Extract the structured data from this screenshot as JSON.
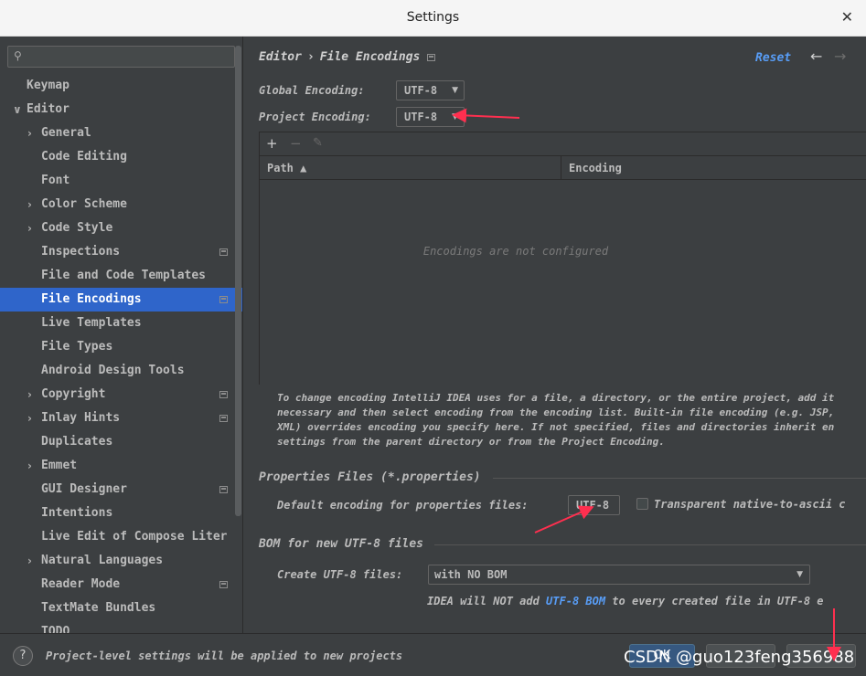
{
  "window": {
    "title": "Settings",
    "close_glyph": "✕"
  },
  "sidebar": {
    "search_icon": "search-icon",
    "items": [
      {
        "label": "Keymap",
        "level": 0,
        "arrow": "",
        "proj": false,
        "selected": false
      },
      {
        "label": "Editor",
        "level": 0,
        "arrow": "∨",
        "proj": false,
        "selected": false
      },
      {
        "label": "General",
        "level": 1,
        "arrow": "›",
        "proj": false,
        "selected": false
      },
      {
        "label": "Code Editing",
        "level": 1,
        "arrow": "",
        "proj": false,
        "selected": false
      },
      {
        "label": "Font",
        "level": 1,
        "arrow": "",
        "proj": false,
        "selected": false
      },
      {
        "label": "Color Scheme",
        "level": 1,
        "arrow": "›",
        "proj": false,
        "selected": false
      },
      {
        "label": "Code Style",
        "level": 1,
        "arrow": "›",
        "proj": false,
        "selected": false
      },
      {
        "label": "Inspections",
        "level": 1,
        "arrow": "",
        "proj": true,
        "selected": false
      },
      {
        "label": "File and Code Templates",
        "level": 1,
        "arrow": "",
        "proj": false,
        "selected": false
      },
      {
        "label": "File Encodings",
        "level": 1,
        "arrow": "",
        "proj": true,
        "selected": true
      },
      {
        "label": "Live Templates",
        "level": 1,
        "arrow": "",
        "proj": false,
        "selected": false
      },
      {
        "label": "File Types",
        "level": 1,
        "arrow": "",
        "proj": false,
        "selected": false
      },
      {
        "label": "Android Design Tools",
        "level": 1,
        "arrow": "",
        "proj": false,
        "selected": false
      },
      {
        "label": "Copyright",
        "level": 1,
        "arrow": "›",
        "proj": true,
        "selected": false
      },
      {
        "label": "Inlay Hints",
        "level": 1,
        "arrow": "›",
        "proj": true,
        "selected": false
      },
      {
        "label": "Duplicates",
        "level": 1,
        "arrow": "",
        "proj": false,
        "selected": false
      },
      {
        "label": "Emmet",
        "level": 1,
        "arrow": "›",
        "proj": false,
        "selected": false
      },
      {
        "label": "GUI Designer",
        "level": 1,
        "arrow": "",
        "proj": true,
        "selected": false
      },
      {
        "label": "Intentions",
        "level": 1,
        "arrow": "",
        "proj": false,
        "selected": false
      },
      {
        "label": "Live Edit of Compose Liter",
        "level": 1,
        "arrow": "",
        "proj": false,
        "selected": false
      },
      {
        "label": "Natural Languages",
        "level": 1,
        "arrow": "›",
        "proj": false,
        "selected": false
      },
      {
        "label": "Reader Mode",
        "level": 1,
        "arrow": "",
        "proj": true,
        "selected": false
      },
      {
        "label": "TextMate Bundles",
        "level": 1,
        "arrow": "",
        "proj": false,
        "selected": false
      },
      {
        "label": "TODO",
        "level": 1,
        "arrow": "",
        "proj": false,
        "selected": false
      }
    ]
  },
  "main": {
    "breadcrumb": {
      "parent": "Editor",
      "separator": "›",
      "current": "File Encodings"
    },
    "reset_label": "Reset",
    "back_glyph": "←",
    "forward_glyph": "→",
    "global_encoding": {
      "label": "Global Encoding:",
      "value": "UTF-8"
    },
    "project_encoding": {
      "label": "Project Encoding:",
      "value": "UTF-8"
    },
    "toolbar": {
      "add": "+",
      "remove": "−",
      "edit": "✎"
    },
    "table": {
      "columns": [
        "Path ▲",
        "Encoding"
      ],
      "empty_text": "Encodings are not configured"
    },
    "hint_lines": [
      "To change encoding IntelliJ IDEA uses for a file, a directory, or the entire project, add it",
      "necessary and then select encoding from the encoding list. Built-in file encoding (e.g. JSP,",
      "XML) overrides encoding you specify here. If not specified, files and directories inherit en",
      "settings from the parent directory or from the Project Encoding."
    ],
    "properties": {
      "section_title": "Properties Files (*.properties)",
      "default_label": "Default encoding for properties files:",
      "default_value": "UTF-8",
      "transparent_label": "Transparent native-to-ascii c",
      "transparent_checked": false
    },
    "bom": {
      "section_title": "BOM for new UTF-8 files",
      "create_label": "Create UTF-8 files:",
      "create_value": "with NO BOM",
      "info_prefix": "IDEA will NOT add ",
      "info_link": "UTF-8 BOM",
      "info_suffix": " to every created file in UTF-8 e"
    }
  },
  "footer": {
    "help_glyph": "?",
    "message": "Project-level settings will be applied to new projects",
    "ok_label": "OK",
    "watermark": "CSDN @guo123feng356988"
  },
  "colors": {
    "background": "#3c3f41",
    "selection": "#2f65ca",
    "link": "#589df6",
    "annotation_arrow": "#ff2f4f"
  }
}
